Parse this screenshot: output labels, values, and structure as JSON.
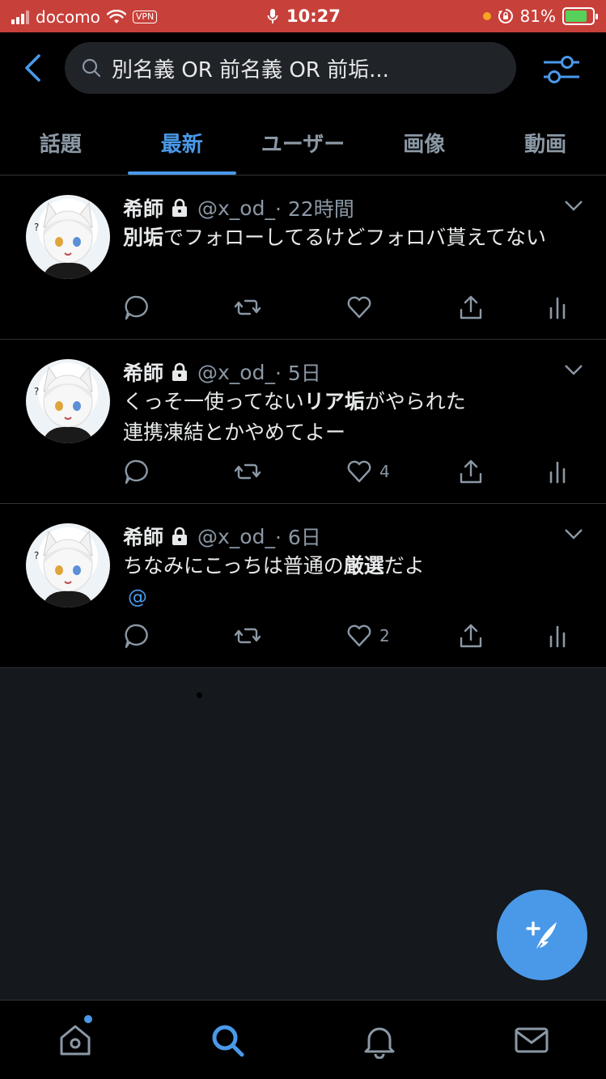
{
  "status_bar": {
    "carrier": "docomo",
    "vpn": "VPN",
    "time": "10:27",
    "battery": "81%",
    "battery_level": 0.81
  },
  "search": {
    "query": "別名義 OR 前名義 OR 前垢..."
  },
  "tabs": [
    {
      "label": "話題",
      "active": false
    },
    {
      "label": "最新",
      "active": true
    },
    {
      "label": "ユーザー",
      "active": false
    },
    {
      "label": "画像",
      "active": false
    },
    {
      "label": "動画",
      "active": false
    }
  ],
  "tweets": [
    {
      "name": "希師",
      "handle": "@x_od_",
      "time": "· 22時間",
      "body_bold_1": "別垢",
      "body_rest_1": "でフォローしてるけどフォロバ貰えてない",
      "likes": ""
    },
    {
      "name": "希師",
      "handle": "@x_od_",
      "time": "· 5日",
      "body_pre": "くっそ一使ってない",
      "body_bold": "リア垢",
      "body_post": "がやられた",
      "body_line2": "連携凍結とかやめてよー",
      "likes": "4"
    },
    {
      "name": "希師",
      "handle": "@x_od_",
      "time": "· 6日",
      "body_pre": "ちなみにこっちは普通の",
      "body_bold": "厳選",
      "body_post": "だよ",
      "mention": "@",
      "likes": "2"
    }
  ],
  "icons": {
    "back": "chevron-left-icon",
    "search": "search-icon",
    "filter": "sliders-icon",
    "compose": "compose-tweet-icon",
    "home": "home-icon",
    "explore": "search-icon",
    "notifications": "bell-icon",
    "messages": "mail-icon"
  },
  "colors": {
    "accent": "#4a99e9",
    "status_bar": "#c8403a",
    "background": "#000000"
  }
}
